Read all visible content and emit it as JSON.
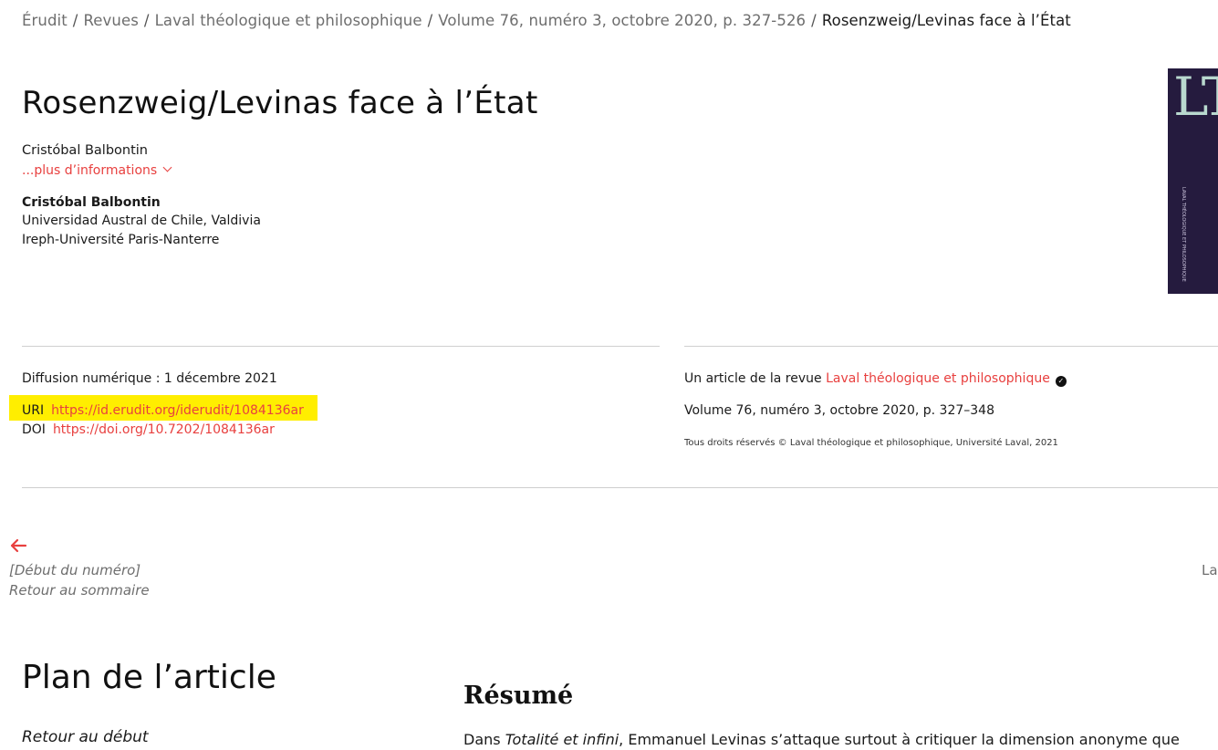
{
  "breadcrumb": [
    {
      "label": "Érudit"
    },
    {
      "label": "Revues"
    },
    {
      "label": "Laval théologique et philosophique"
    },
    {
      "label": "Volume 76, numéro 3, octobre 2020, p. 327-526"
    },
    {
      "label": "Rosenzweig/Levinas face à l’État"
    }
  ],
  "article": {
    "title": "Rosenzweig/Levinas face à l’État",
    "author_line": "Cristóbal Balbontin",
    "more_info_label": "...plus d’informations",
    "author_name": "Cristóbal Balbontin",
    "affiliations": [
      "Universidad Austral de Chile, Valdivia",
      "Ireph-Université Paris-Nanterre"
    ]
  },
  "cover": {
    "letters": "LTP",
    "spine_text": "LAVAL THÉOLOGIQUE ET PHILOSOPHIQUE"
  },
  "meta": {
    "diffusion": "Diffusion numérique : 1 décembre 2021",
    "uri_label": "URI",
    "uri_value": "https://id.erudit.org/iderudit/1084136ar",
    "doi_label": "DOI",
    "doi_value": "https://doi.org/10.7202/1084136ar",
    "journal_prefix": "Un article de la revue",
    "journal_name": "Laval théologique et philosophique",
    "volume": "Volume 76, numéro 3, octobre 2020, p. 327–348",
    "rights": "Tous droits réservés © Laval théologique et philosophique, Université Laval, 2021"
  },
  "nav": {
    "prev_label": "[Début du numéro]",
    "toc_label": "Retour au sommaire",
    "next_peek": "La"
  },
  "plan": {
    "title": "Plan de l’article",
    "back_to_top": "Retour au début"
  },
  "resume": {
    "title": "Résumé",
    "text_before": "Dans",
    "text_italic": "Totalité et infini",
    "text_after": ", Emmanuel Levinas s’attaque surtout à critiquer la dimension anonyme que"
  },
  "colors": {
    "accent": "#e8403f",
    "highlight": "#ffee00",
    "cover": "#251b3e"
  }
}
